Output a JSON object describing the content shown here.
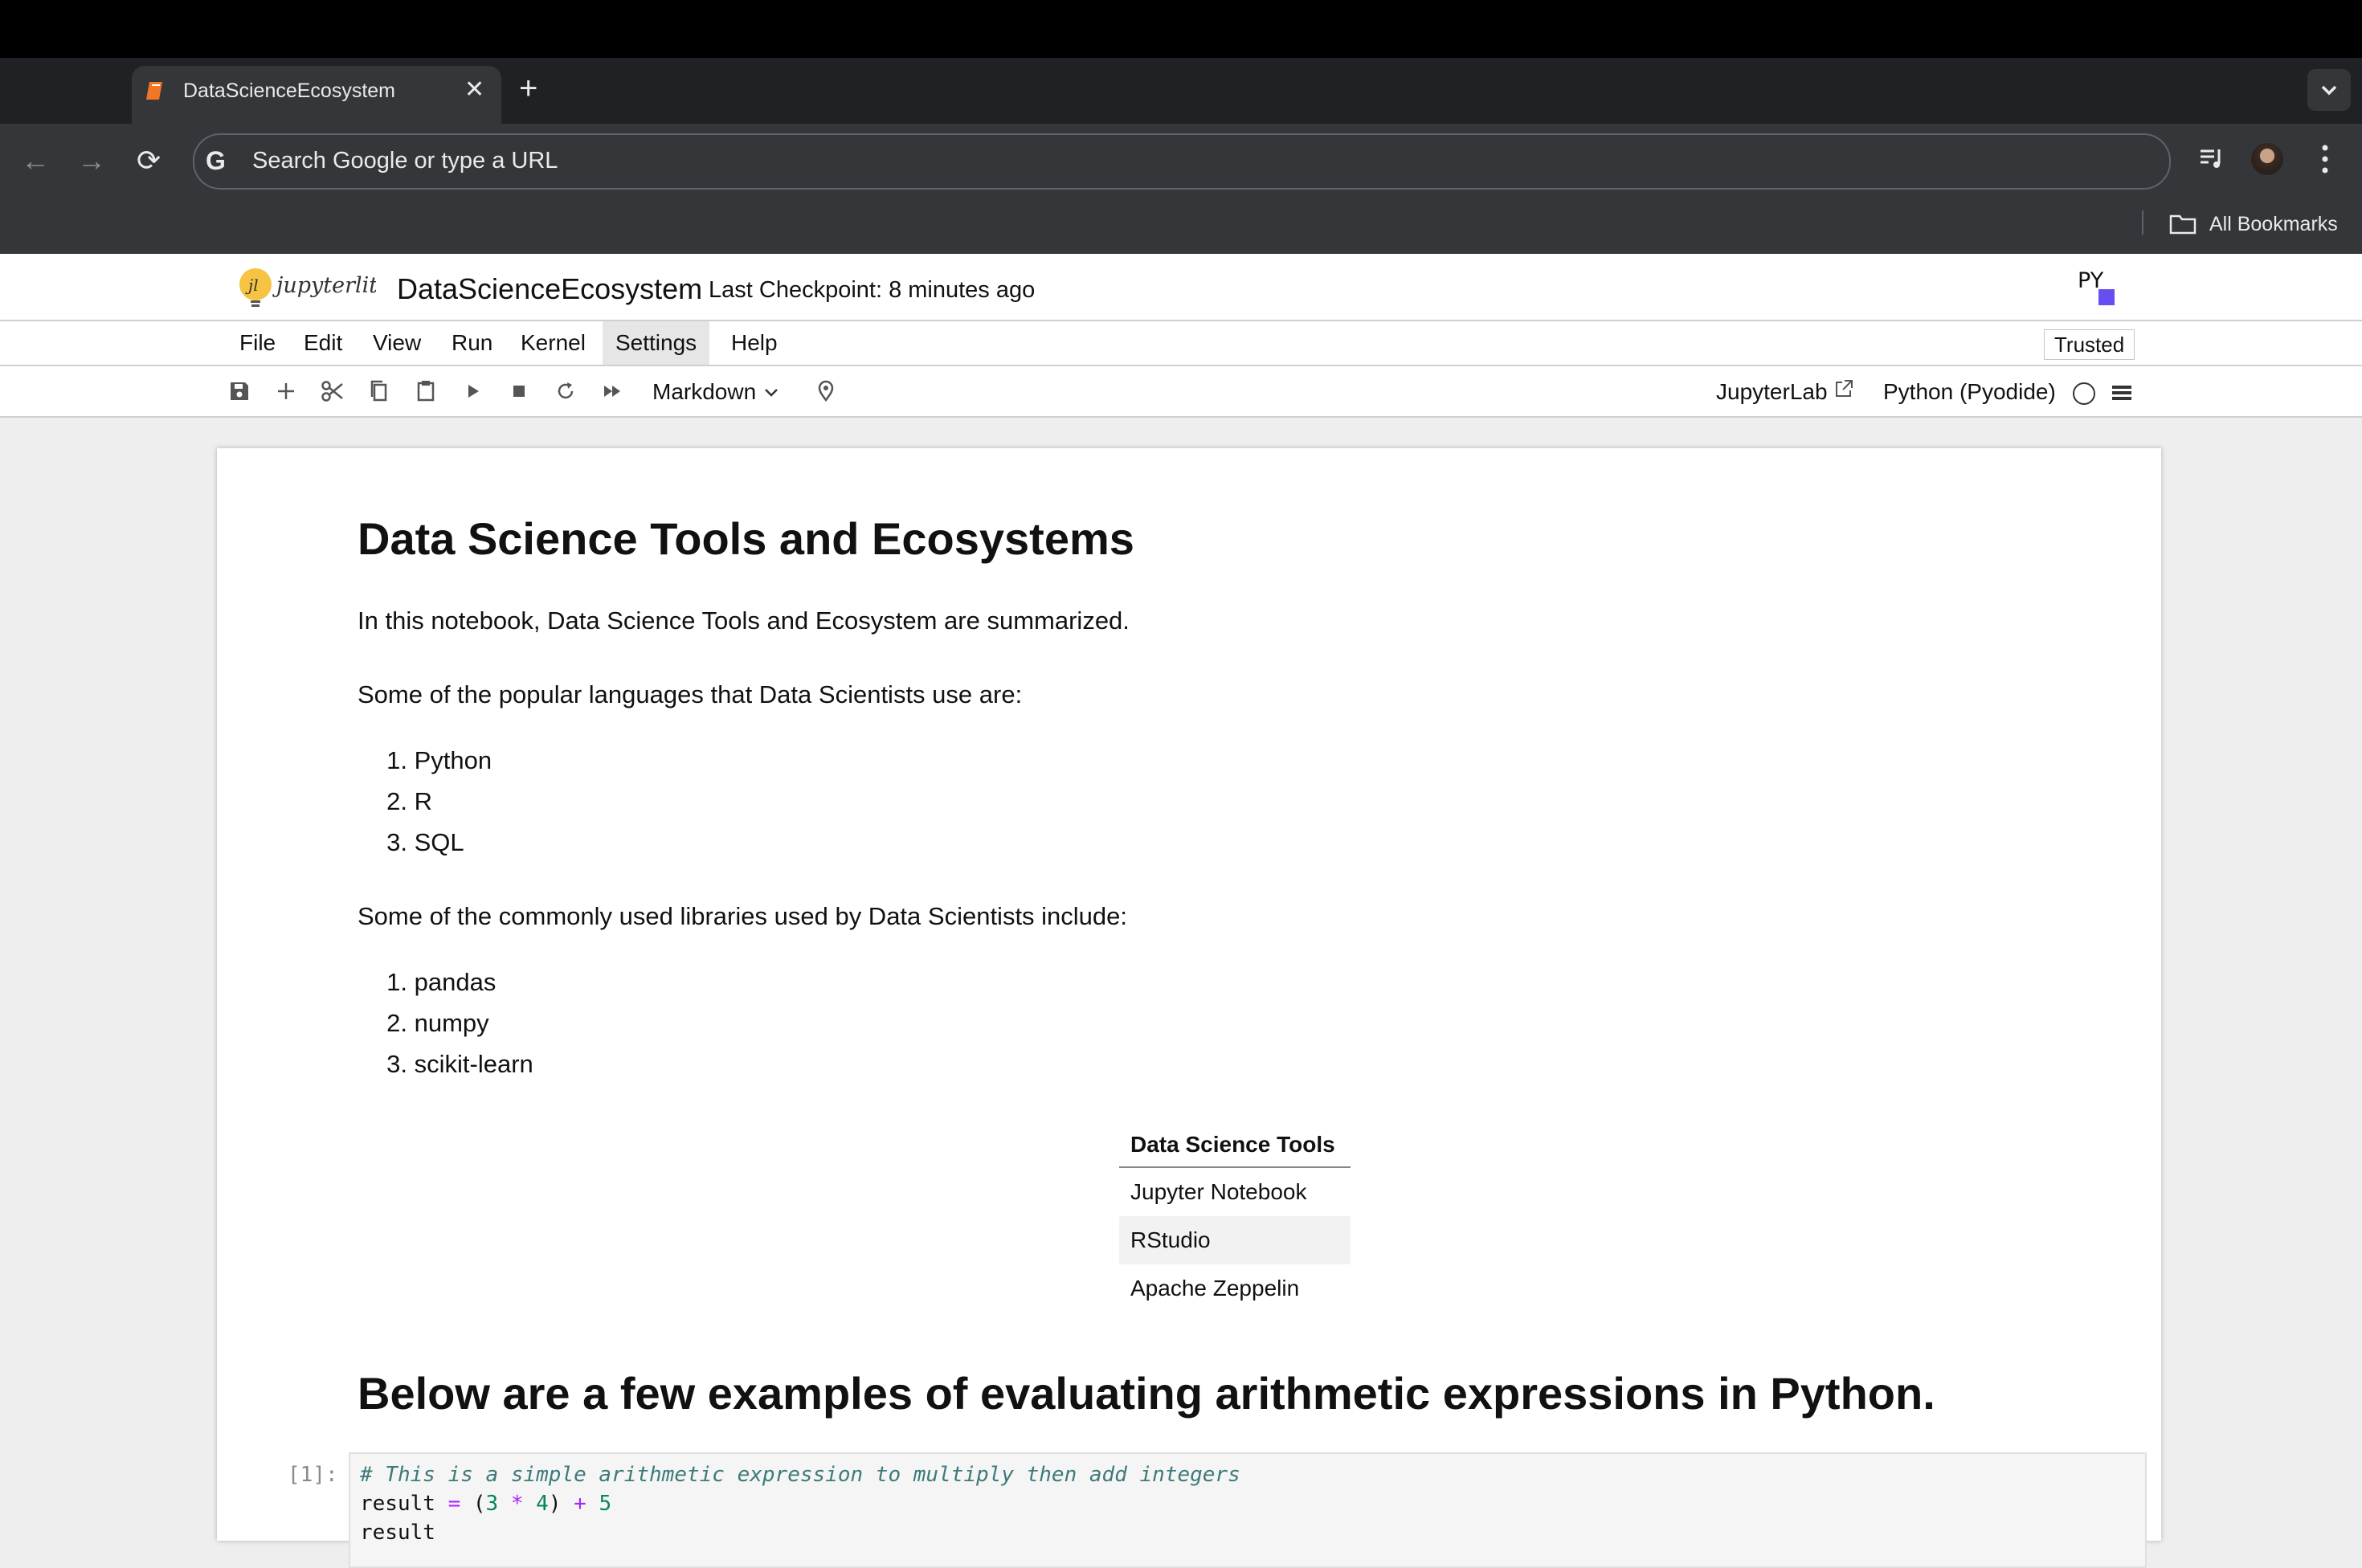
{
  "browser": {
    "tab_title": "DataScienceEcosystem",
    "omnibox_placeholder": "Search Google or type a URL",
    "bookmarks_label": "All Bookmarks"
  },
  "notebook": {
    "logo_text": "jupyterlite",
    "title": "DataScienceEcosystem",
    "checkpoint": "Last Checkpoint: 8 minutes ago",
    "py_logo_text": "PY",
    "trusted_label": "Trusted",
    "menu": [
      "File",
      "Edit",
      "View",
      "Run",
      "Kernel",
      "Settings",
      "Help"
    ],
    "cell_type": "Markdown",
    "jupyterlab_link": "JupyterLab",
    "kernel_name": "Python (Pyodide)"
  },
  "content": {
    "heading1": "Data Science Tools and Ecosystems",
    "intro": "In this notebook, Data Science Tools and Ecosystem are summarized.",
    "languages_intro": "Some of the popular languages that Data Scientists use are:",
    "languages": [
      "Python",
      "R",
      "SQL"
    ],
    "libraries_intro": "Some of the commonly used libraries used by Data Scientists include:",
    "libraries": [
      "pandas",
      "numpy",
      "scikit-learn"
    ],
    "tools_table": {
      "header": "Data Science Tools",
      "rows": [
        "Jupyter Notebook",
        "RStudio",
        "Apache Zeppelin"
      ]
    },
    "heading2": "Below are a few examples of evaluating arithmetic expressions in Python.",
    "code_prompt": "[1]:",
    "code_lines": [
      "# This is a simple arithmetic expression to multiply then add integers",
      "result = (3 * 4) + 5",
      "result"
    ]
  }
}
